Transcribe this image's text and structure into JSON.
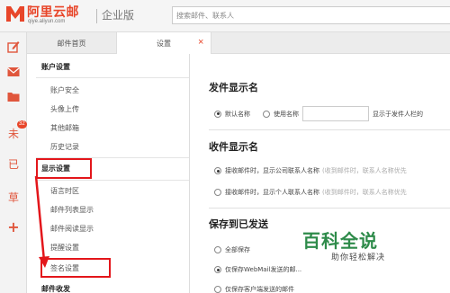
{
  "header": {
    "logo_text": "阿里云邮",
    "logo_url": "qiye.aliyun.com",
    "edition": "企业版",
    "search_placeholder": "搜索邮件、联系人"
  },
  "iconbar": {
    "icons": [
      "compose-icon",
      "inbox-icon",
      "folder-icon",
      "unread-icon",
      "sent-icon",
      "draft-icon",
      "add-icon"
    ],
    "unread_char": "未",
    "unread_badge": "32",
    "sent_char": "已",
    "draft_char": "草",
    "add_char": "+"
  },
  "tabs": {
    "home": "邮件首页",
    "settings": "设置",
    "close": "×"
  },
  "sidebar": {
    "account_settings": "账户设置",
    "account_security": "账户安全",
    "avatar_upload": "头像上传",
    "other_mailbox": "其他邮箱",
    "history": "历史记录",
    "display_settings": "显示设置",
    "language_timezone": "语言时区",
    "mail_list_display": "邮件列表显示",
    "mail_read_display": "邮件阅读显示",
    "reminder_settings": "提醒设置",
    "signature_settings": "签名设置",
    "mail_send_receive": "邮件收发"
  },
  "main": {
    "sender_name_title": "发件显示名",
    "default_name": "默认名称",
    "use_name": "使用名称",
    "sender_name_hint": "显示于发件人栏的",
    "receiver_name_title": "收件显示名",
    "receive_company_name": "接收邮件时，显示公司联系人名称",
    "receive_company_hint": "(收到邮件时，联系人名称优先",
    "receive_personal_name": "接收邮件时，显示个人联系人名称",
    "receive_personal_hint": "(收到邮件时，联系人名称优先",
    "save_sent_title": "保存到已发送",
    "save_all": "全部保存",
    "save_webmail": "仅保存WebMail发送的邮...",
    "save_client": "仅保存客户端发送的邮件"
  },
  "watermark": {
    "big": "百科全说",
    "small": "助你轻松解决"
  },
  "colors": {
    "brand": "#e8462a",
    "highlight_box": "#e3161b",
    "watermark": "#2e8b4a"
  }
}
